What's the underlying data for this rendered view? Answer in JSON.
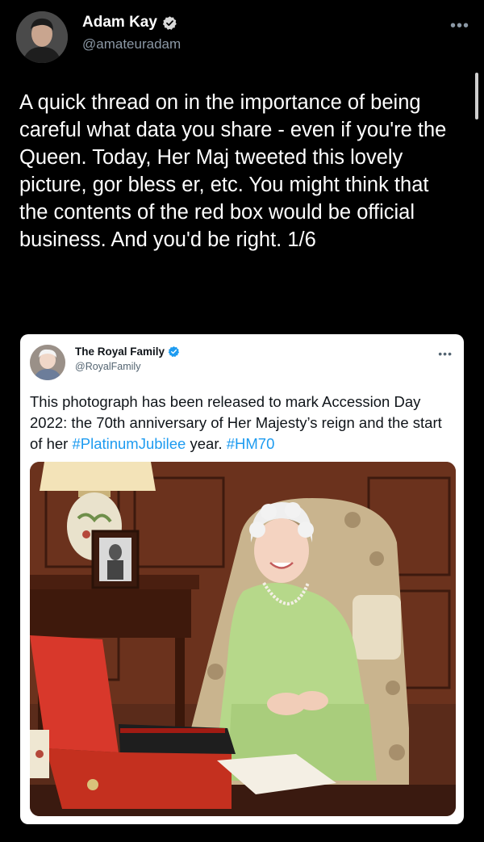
{
  "author": {
    "name": "Adam Kay",
    "handle": "@amateuradam"
  },
  "tweet": {
    "text": "A quick thread on in the importance of being careful what data you share - even if you're the Queen. Today, Her Maj tweeted this lovely picture, gor bless er, etc. You might think that the contents of the red box would be official business. And you'd be right. 1/6"
  },
  "quoted": {
    "name": "The Royal Family",
    "handle": "@RoyalFamily",
    "text_part1": "This photograph has been released to mark Accession Day 2022: the 70th anniversary of Her Majesty’s reign and the start of her ",
    "hashtag1": "#PlatinumJubilee",
    "text_part2": " year. ",
    "hashtag2": "#HM70"
  },
  "icons": {
    "verified": "verified-badge-icon",
    "more": "more-options-icon"
  },
  "colors": {
    "background": "#000000",
    "link": "#1d9bf0",
    "verified": "#1d9bf0",
    "red_box": "#d8382b",
    "dress": "#b6d88a"
  }
}
